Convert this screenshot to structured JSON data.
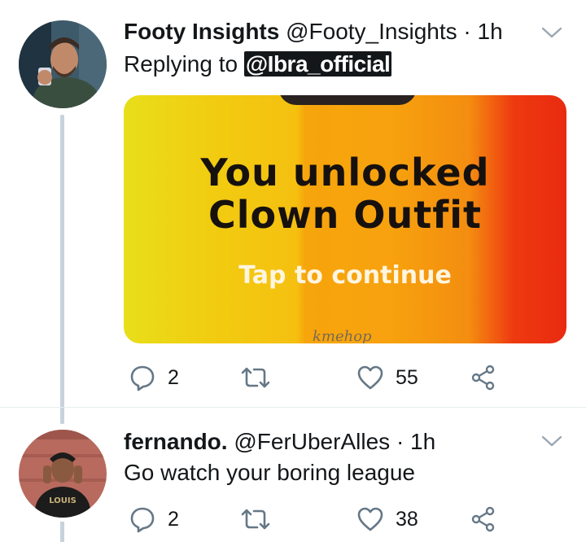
{
  "tweets": [
    {
      "name": "Footy Insights",
      "handle": "@Footy_Insights",
      "separator": "·",
      "time": "1h",
      "reply_prefix": "Replying to",
      "reply_mention": "@Ibra_official",
      "media": {
        "line1": "You unlocked",
        "line2": "Clown Outfit",
        "tap": "Tap to continue",
        "watermark": "kmehop"
      },
      "replies": "2",
      "retweets": "",
      "likes": "55"
    },
    {
      "name": "fernando.",
      "handle": "@FerUberAlles",
      "separator": "·",
      "time": "1h",
      "text": "Go watch your boring league",
      "replies": "2",
      "retweets": "",
      "likes": "38"
    }
  ],
  "icons": {
    "reply": "reply-icon",
    "retweet": "retweet-icon",
    "like": "heart-icon",
    "share": "share-icon",
    "more": "chevron-down-icon"
  },
  "colors": {
    "icon": "#657786",
    "thread_line": "#c7d2dc"
  }
}
